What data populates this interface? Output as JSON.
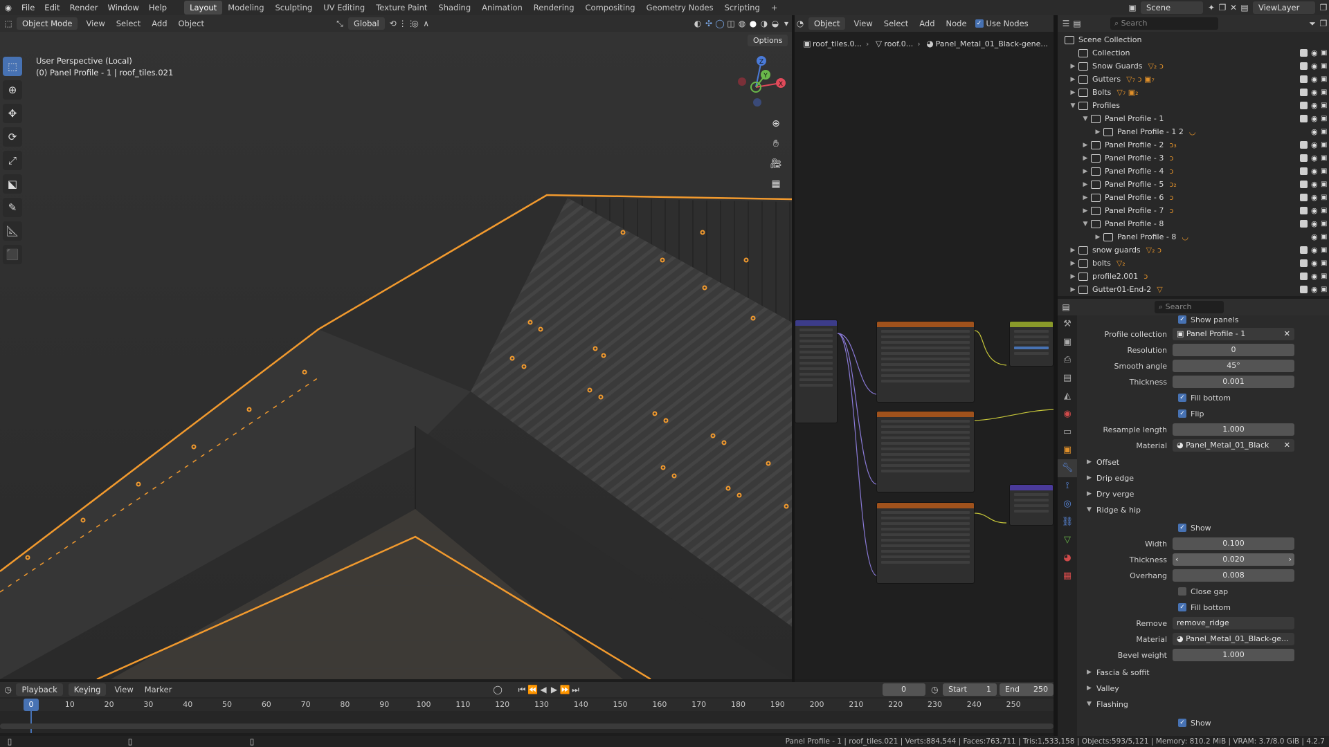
{
  "topbar": {
    "menus": [
      "File",
      "Edit",
      "Render",
      "Window",
      "Help"
    ],
    "workspaces": [
      "Layout",
      "Modeling",
      "Sculpting",
      "UV Editing",
      "Texture Paint",
      "Shading",
      "Animation",
      "Rendering",
      "Compositing",
      "Geometry Nodes",
      "Scripting"
    ],
    "active_workspace": "Layout",
    "scene": "Scene",
    "view_layer": "ViewLayer"
  },
  "viewport_header": {
    "mode": "Object Mode",
    "menus": [
      "View",
      "Select",
      "Add",
      "Object"
    ],
    "orientation": "Global",
    "options": "Options"
  },
  "viewport": {
    "view_name": "User Perspective (Local)",
    "object_info": "(0) Panel Profile - 1 | roof_tiles.021",
    "gizmo_axes": [
      "X",
      "Y",
      "Z"
    ]
  },
  "node_editor": {
    "type": "Object",
    "menus": [
      "View",
      "Select",
      "Add",
      "Node"
    ],
    "use_nodes": "Use Nodes",
    "breadcrumb": [
      "roof_tiles.0...",
      "roof.0...",
      "Panel_Metal_01_Black-gene..."
    ]
  },
  "outliner": {
    "search_placeholder": "Search",
    "root": "Scene Collection",
    "items": [
      {
        "label": "Collection",
        "indent": 0,
        "expanded": null,
        "badge": ""
      },
      {
        "label": "Snow Guards",
        "indent": 0,
        "expanded": false,
        "badge": "▽₂ ↄ"
      },
      {
        "label": "Gutters",
        "indent": 0,
        "expanded": false,
        "badge": "▽₇ ↄ ▣₇"
      },
      {
        "label": "Bolts",
        "indent": 0,
        "expanded": false,
        "badge": "▽₇ ▣₂"
      },
      {
        "label": "Profiles",
        "indent": 0,
        "expanded": true,
        "badge": ""
      },
      {
        "label": "Panel Profile - 1",
        "indent": 1,
        "expanded": true,
        "badge": ""
      },
      {
        "label": "Panel Profile - 1 2",
        "indent": 2,
        "expanded": false,
        "badge": "◡"
      },
      {
        "label": "Panel Profile - 2",
        "indent": 1,
        "expanded": false,
        "badge": "ↄ₃"
      },
      {
        "label": "Panel Profile - 3",
        "indent": 1,
        "expanded": false,
        "badge": "ↄ"
      },
      {
        "label": "Panel Profile - 4",
        "indent": 1,
        "expanded": false,
        "badge": "ↄ"
      },
      {
        "label": "Panel Profile - 5",
        "indent": 1,
        "expanded": false,
        "badge": "ↄ₂"
      },
      {
        "label": "Panel Profile - 6",
        "indent": 1,
        "expanded": false,
        "badge": "ↄ"
      },
      {
        "label": "Panel Profile - 7",
        "indent": 1,
        "expanded": false,
        "badge": "ↄ"
      },
      {
        "label": "Panel Profile - 8",
        "indent": 1,
        "expanded": true,
        "badge": ""
      },
      {
        "label": "Panel Profile - 8",
        "indent": 2,
        "expanded": false,
        "badge": "◡"
      },
      {
        "label": "snow guards",
        "indent": 0,
        "expanded": false,
        "badge": "▽₂ ↄ"
      },
      {
        "label": "bolts",
        "indent": 0,
        "expanded": false,
        "badge": "▽₂"
      },
      {
        "label": "profile2.001",
        "indent": 0,
        "expanded": false,
        "badge": "ↄ"
      },
      {
        "label": "Gutter01-End-2",
        "indent": 0,
        "expanded": false,
        "badge": "▽"
      }
    ]
  },
  "properties": {
    "search_placeholder": "Search",
    "top_partial": "Show panels",
    "fields": {
      "profile_collection": {
        "label": "Profile collection",
        "value": "Panel Profile - 1"
      },
      "resolution": {
        "label": "Resolution",
        "value": "0"
      },
      "smooth_angle": {
        "label": "Smooth angle",
        "value": "45°"
      },
      "thickness": {
        "label": "Thickness",
        "value": "0.001"
      },
      "fill_bottom": {
        "label": "Fill bottom"
      },
      "flip": {
        "label": "Flip"
      },
      "resample_length": {
        "label": "Resample length",
        "value": "1.000"
      },
      "material": {
        "label": "Material",
        "value": "Panel_Metal_01_Black"
      }
    },
    "sections": {
      "offset": "Offset",
      "drip_edge": "Drip edge",
      "dry_verge": "Dry verge",
      "ridge_hip": "Ridge & hip",
      "fascia": "Fascia & soffit",
      "valley": "Valley",
      "flashing": "Flashing"
    },
    "ridge": {
      "show": "Show",
      "width": {
        "label": "Width",
        "value": "0.100"
      },
      "thickness": {
        "label": "Thickness",
        "value": "0.020"
      },
      "overhang": {
        "label": "Overhang",
        "value": "0.008"
      },
      "close_gap": "Close gap",
      "fill_bottom": "Fill bottom",
      "remove": {
        "label": "Remove",
        "value": "remove_ridge"
      },
      "material": {
        "label": "Material",
        "value": "Panel_Metal_01_Black-ge..."
      },
      "bevel_weight": {
        "label": "Bevel weight",
        "value": "1.000"
      }
    },
    "flashing_show": "Show"
  },
  "timeline": {
    "menus": [
      "Playback",
      "Keying",
      "View",
      "Marker"
    ],
    "current_frame": "0",
    "start_label": "Start",
    "start": "1",
    "end_label": "End",
    "end": "250",
    "ticks": [
      "0",
      "10",
      "20",
      "30",
      "40",
      "50",
      "60",
      "70",
      "80",
      "90",
      "100",
      "110",
      "120",
      "130",
      "140",
      "150",
      "160",
      "170",
      "180",
      "190",
      "200",
      "210",
      "220",
      "230",
      "240",
      "250"
    ]
  },
  "statusbar": {
    "text": "Panel Profile - 1 | roof_tiles.021 | Verts:884,544 | Faces:763,711 | Tris:1,533,158 | Objects:593/5,121 | Memory: 810.2 MiB | VRAM: 3.7/8.0 GiB | 4.2.7"
  },
  "colors": {
    "accent": "#4772b3",
    "selection": "#f29a2e",
    "node_header": "#a0521c"
  }
}
